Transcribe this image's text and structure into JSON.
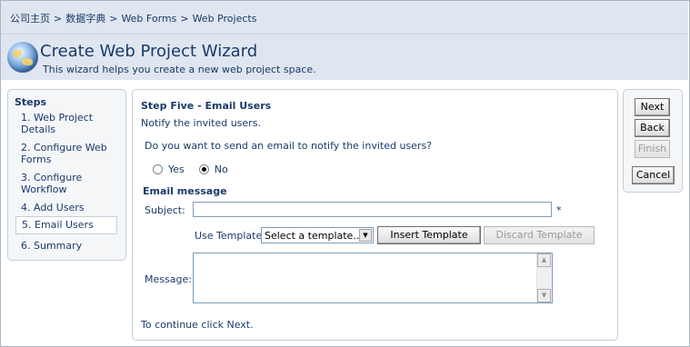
{
  "breadcrumb": {
    "items": [
      "公司主页",
      "数据字典",
      "Web Forms",
      "Web Projects"
    ],
    "separator": ">"
  },
  "wizard": {
    "title": "Create Web Project Wizard",
    "subtitle": "This wizard helps you create a new web project space."
  },
  "steps": {
    "title": "Steps",
    "items": [
      {
        "label": "1. Web Project Details",
        "active": false
      },
      {
        "label": "2. Configure Web Forms",
        "active": false
      },
      {
        "label": "3. Configure Workflow",
        "active": false
      },
      {
        "label": "4. Add Users",
        "active": false
      },
      {
        "label": "5. Email Users",
        "active": true
      },
      {
        "label": "6. Summary",
        "active": false
      }
    ]
  },
  "main": {
    "heading": "Step Five - Email Users",
    "description": "Notify the invited users.",
    "question": "Do you want to send an email to notify the invited users?",
    "options": [
      {
        "label": "Yes",
        "checked": false
      },
      {
        "label": "No",
        "checked": true
      }
    ],
    "email_heading": "Email message",
    "subject_label": "Subject:",
    "subject_value": "",
    "required_marker": "*",
    "template_label": "Use Template:",
    "template_selected": "Select a template...",
    "insert_template": "Insert Template",
    "discard_template": "Discard Template",
    "message_label": "Message:",
    "message_value": "",
    "continue_text": "To continue click Next."
  },
  "nav": {
    "next": "Next",
    "back": "Back",
    "finish": "Finish",
    "cancel": "Cancel"
  },
  "colors": {
    "header_bg": "#dfe6ef",
    "text_accent": "#1a3a6a",
    "panel_border": "#c5cdd8"
  }
}
